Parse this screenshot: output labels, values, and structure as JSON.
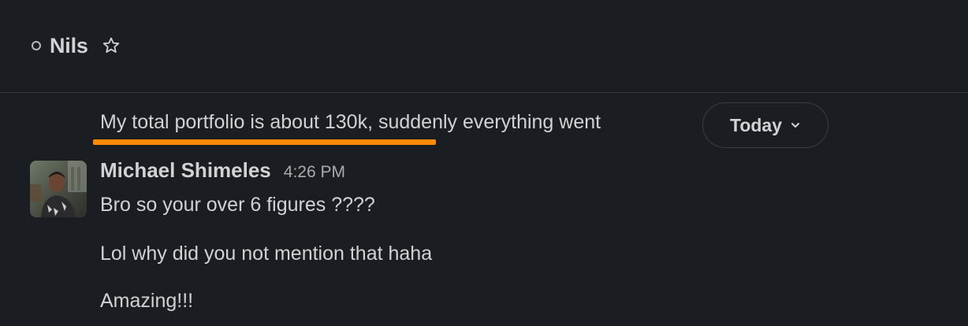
{
  "header": {
    "channel_name": "Nils",
    "presence_icon": "presence-away-icon",
    "star_icon": "star-outline-icon"
  },
  "previous_message": {
    "text": "My total portfolio is about 130k, suddenly everything went",
    "highlight_color": "#ff8a00"
  },
  "date_divider": {
    "label": "Today",
    "icon": "chevron-down-icon"
  },
  "message_group": {
    "sender": "Michael Shimeles",
    "time": "4:26 PM",
    "avatar": "user-avatar",
    "messages": [
      "Bro so your over 6 figures ????",
      "Lol why did you not mention that haha",
      "Amazing!!!"
    ]
  },
  "colors": {
    "background": "#1a1d21",
    "text": "#d1d2d3",
    "muted": "#ababad",
    "accent": "#ff8a00"
  }
}
